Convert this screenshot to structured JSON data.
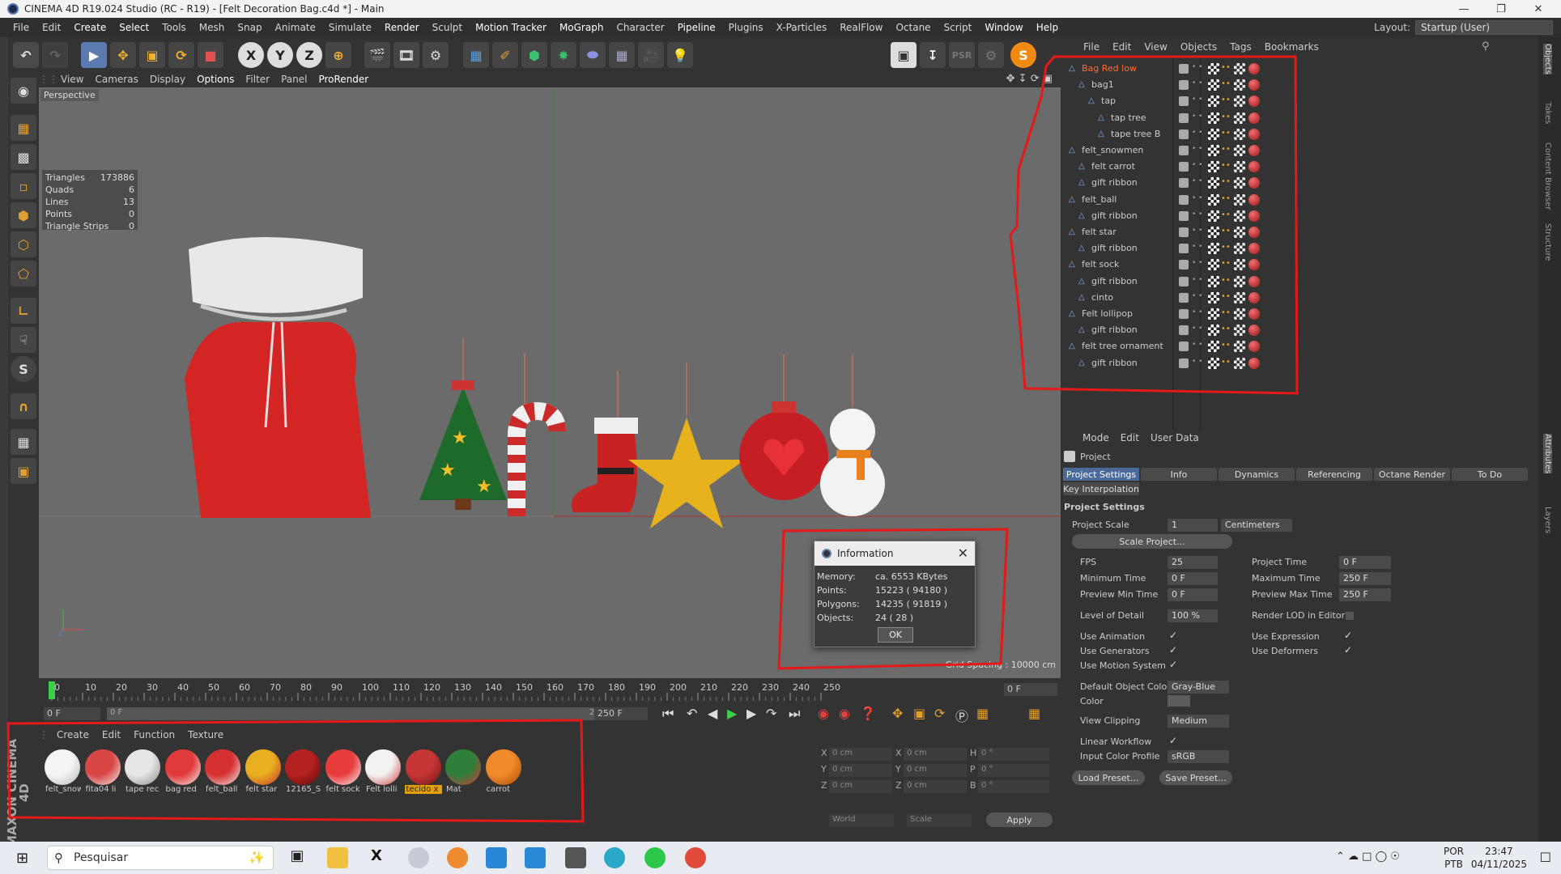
{
  "window": {
    "title": "CINEMA 4D R19.024 Studio (RC - R19) - [Felt Decoration Bag.c4d *] - Main"
  },
  "menubar": {
    "items": [
      "File",
      "Edit",
      "Create",
      "Select",
      "Tools",
      "Mesh",
      "Snap",
      "Animate",
      "Simulate",
      "Render",
      "Sculpt",
      "Motion Tracker",
      "MoGraph",
      "Character",
      "Pipeline",
      "Plugins",
      "X-Particles",
      "RealFlow",
      "Octane",
      "Script",
      "Window",
      "Help"
    ],
    "layout_label": "Layout:",
    "layout_value": "Startup (User)"
  },
  "viewport": {
    "menu": [
      "View",
      "Cameras",
      "Display",
      "Options",
      "Filter",
      "Panel",
      "ProRender"
    ],
    "camera": "Perspective",
    "hud": [
      {
        "k": "Triangles",
        "v": "173886"
      },
      {
        "k": "Quads",
        "v": "6"
      },
      {
        "k": "Lines",
        "v": "13"
      },
      {
        "k": "Points",
        "v": "0"
      },
      {
        "k": "Triangle Strips",
        "v": "0"
      }
    ],
    "grid_spacing": "Grid Spacing : 10000 cm"
  },
  "info_dialog": {
    "title": "Information",
    "rows": [
      {
        "k": "Memory:",
        "v": "ca. 6553 KBytes"
      },
      {
        "k": "Points:",
        "v": "15223 ( 94180 )"
      },
      {
        "k": "Polygons:",
        "v": "14235 ( 91819 )"
      },
      {
        "k": "Objects:",
        "v": "24 ( 28 )"
      }
    ],
    "ok": "OK"
  },
  "timeline": {
    "ticks": [
      "0",
      "10",
      "20",
      "30",
      "40",
      "50",
      "60",
      "70",
      "80",
      "90",
      "100",
      "110",
      "120",
      "130",
      "140",
      "150",
      "160",
      "170",
      "180",
      "190",
      "200",
      "210",
      "220",
      "230",
      "240",
      "250"
    ],
    "current_frame": "0 F",
    "start": "0 F",
    "start2": "0 F",
    "end2": "250 F",
    "end": "250 F"
  },
  "materials": {
    "menu": [
      "Create",
      "Edit",
      "Function",
      "Texture"
    ],
    "items": [
      {
        "label": "felt_snow",
        "c1": "#f4f4f4",
        "c2": "#b9b9b9"
      },
      {
        "label": "fita04 li",
        "c1": "#d84646",
        "c2": "#f2f2f2"
      },
      {
        "label": "tape rec",
        "c1": "#e6e6e6",
        "c2": "#8a8a8a"
      },
      {
        "label": "bag red",
        "c1": "#e13a3a",
        "c2": "#f4f4f4"
      },
      {
        "label": "felt_ball",
        "c1": "#d63131",
        "c2": "#f2f2f2"
      },
      {
        "label": "felt star",
        "c1": "#e8b020",
        "c2": "#c63333"
      },
      {
        "label": "12165_S",
        "c1": "#b52020",
        "c2": "#5a0d0d"
      },
      {
        "label": "felt sock",
        "c1": "#e83c3c",
        "c2": "#f5f5f5"
      },
      {
        "label": "Felt lolli",
        "c1": "#f2f2f2",
        "c2": "#d23c3c"
      },
      {
        "label": "tecido x",
        "c1": "#c73636",
        "c2": "#6e1212"
      },
      {
        "label": "Mat",
        "c1": "#2f7f3a",
        "c2": "#d63a3a"
      },
      {
        "label": "carrot",
        "c1": "#f08a2a",
        "c2": "#a64c0c"
      }
    ],
    "selected_index": 9
  },
  "coords": {
    "rows": [
      {
        "a": "X",
        "p": "0 cm",
        "b": "X",
        "s": "0 cm",
        "c": "H",
        "r": "0 °"
      },
      {
        "a": "Y",
        "p": "0 cm",
        "b": "Y",
        "s": "0 cm",
        "c": "P",
        "r": "0 °"
      },
      {
        "a": "Z",
        "p": "0 cm",
        "b": "Z",
        "s": "0 cm",
        "c": "B",
        "r": "0 °"
      }
    ],
    "mode1": "World",
    "mode2": "Scale",
    "apply": "Apply"
  },
  "objects": {
    "menu": [
      "File",
      "Edit",
      "View",
      "Objects",
      "Tags",
      "Bookmarks"
    ],
    "rows": [
      {
        "name": "Bag Red low",
        "level": 0,
        "hl": true
      },
      {
        "name": "bag1",
        "level": 1
      },
      {
        "name": "tap",
        "level": 2
      },
      {
        "name": "tap tree",
        "level": 3
      },
      {
        "name": "tape tree B",
        "level": 3
      },
      {
        "name": "felt_snowmen",
        "level": 0
      },
      {
        "name": "felt carrot",
        "level": 1
      },
      {
        "name": "gift ribbon",
        "level": 1
      },
      {
        "name": "felt_ball",
        "level": 0
      },
      {
        "name": "gift ribbon",
        "level": 1
      },
      {
        "name": "felt star",
        "level": 0
      },
      {
        "name": "gift ribbon",
        "level": 1
      },
      {
        "name": "felt sock",
        "level": 0
      },
      {
        "name": "gift ribbon",
        "level": 1
      },
      {
        "name": "cinto",
        "level": 1
      },
      {
        "name": "Felt lollipop",
        "level": 0
      },
      {
        "name": "gift ribbon",
        "level": 1
      },
      {
        "name": "felt tree ornament",
        "level": 0
      },
      {
        "name": "gift ribbon",
        "level": 1
      }
    ]
  },
  "attributes": {
    "menu": [
      "Mode",
      "Edit",
      "User Data"
    ],
    "section": "Project",
    "tabs": [
      "Project Settings",
      "Info",
      "Dynamics",
      "Referencing",
      "Octane Render",
      "To Do"
    ],
    "tab2": "Key Interpolation",
    "group": "Project Settings",
    "project_scale_label": "Project Scale",
    "project_scale": "1",
    "project_scale_unit": "Centimeters",
    "scale_project": "Scale Project...",
    "fps_label": "FPS",
    "fps": "25",
    "project_time_label": "Project Time",
    "project_time": "0 F",
    "min_time_label": "Minimum Time",
    "min_time": "0 F",
    "max_time_label": "Maximum Time",
    "max_time": "250 F",
    "prev_min_label": "Preview Min Time",
    "prev_min": "0 F",
    "prev_max_label": "Preview Max Time",
    "prev_max": "250 F",
    "lod_label": "Level of Detail",
    "lod": "100 %",
    "render_lod_label": "Render LOD in Editor",
    "use_anim_label": "Use Animation",
    "use_expr_label": "Use Expression",
    "use_gen_label": "Use Generators",
    "use_def_label": "Use Deformers",
    "use_motion_label": "Use Motion System",
    "default_color_label": "Default Object Color",
    "default_color": "Gray-Blue",
    "color_label": "Color",
    "view_clip_label": "View Clipping",
    "view_clip": "Medium",
    "linear_label": "Linear Workflow",
    "input_color_label": "Input Color Profile",
    "input_color": "sRGB",
    "load_preset": "Load Preset...",
    "save_preset": "Save Preset..."
  },
  "rside_tabs": [
    "Objects",
    "Takes",
    "Content Browser",
    "Structure",
    "Attributes",
    "Layers"
  ],
  "taskbar": {
    "search": "Pesquisar",
    "lang1": "POR",
    "lang2": "PTB",
    "time": "23:47",
    "date": "04/11/2025"
  }
}
